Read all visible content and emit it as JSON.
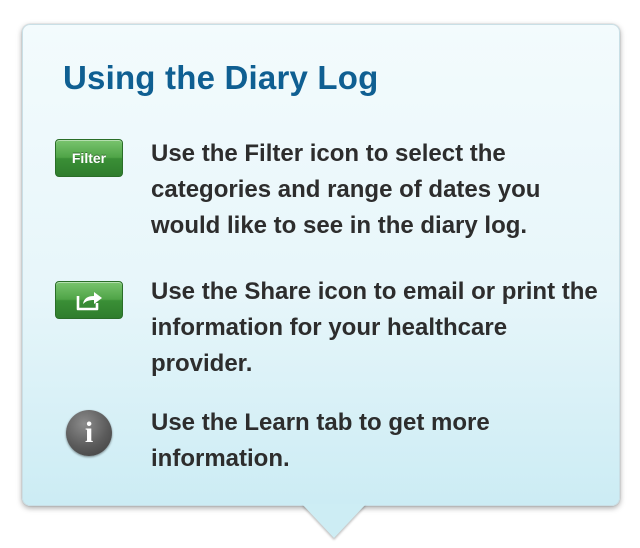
{
  "title": "Using the Diary Log",
  "rows": [
    {
      "icon": "filter-button-icon",
      "icon_label": "Filter",
      "text": "Use the Filter icon to select the categories and range of dates you would like to see in the diary log."
    },
    {
      "icon": "share-icon",
      "text": "Use the Share icon to email or print the information for your healthcare provider."
    },
    {
      "icon": "info-icon",
      "icon_label": "i",
      "text": "Use the Learn tab to get more information."
    }
  ],
  "colors": {
    "title": "#0f5f92",
    "body_text": "#2d2d2d",
    "button_green": "#4fa447",
    "info_gray": "#5b5b5b",
    "panel_bg": "#e7f6fa"
  }
}
